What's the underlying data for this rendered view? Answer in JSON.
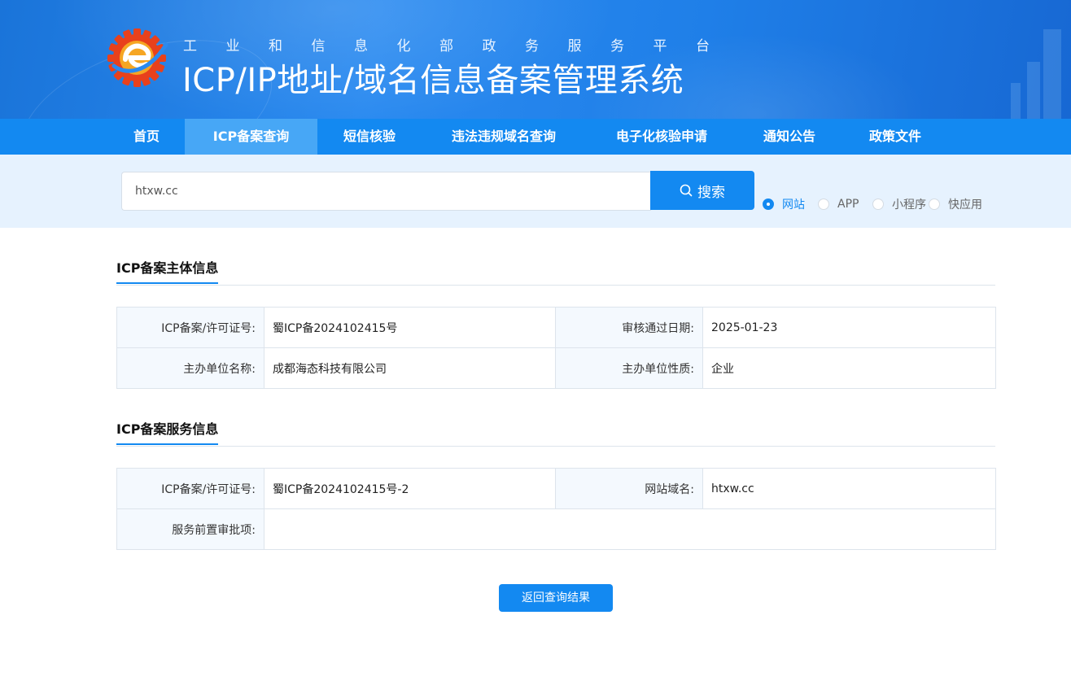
{
  "header": {
    "subtitle": "工业和信息化部政务服务平台",
    "title": "ICP/IP地址/域名信息备案管理系统"
  },
  "nav": {
    "items": [
      {
        "label": "首页"
      },
      {
        "label": "ICP备案查询",
        "active": true
      },
      {
        "label": "短信核验"
      },
      {
        "label": "违法违规域名查询"
      },
      {
        "label": "电子化核验申请"
      },
      {
        "label": "通知公告"
      },
      {
        "label": "政策文件"
      }
    ]
  },
  "search": {
    "value": "htxw.cc",
    "button_label": "搜索",
    "types": [
      {
        "label": "网站",
        "checked": true
      },
      {
        "label": "APP",
        "checked": false
      },
      {
        "label": "小程序",
        "checked": false
      },
      {
        "label": "快应用",
        "checked": false
      }
    ]
  },
  "subject_info": {
    "title": "ICP备案主体信息",
    "license_label": "ICP备案/许可证号:",
    "license_value": "蜀ICP备2024102415号",
    "date_label": "审核通过日期:",
    "date_value": "2025-01-23",
    "org_label": "主办单位名称:",
    "org_value": "成都海态科技有限公司",
    "nature_label": "主办单位性质:",
    "nature_value": "企业"
  },
  "service_info": {
    "title": "ICP备案服务信息",
    "license_label": "ICP备案/许可证号:",
    "license_value": "蜀ICP备2024102415号-2",
    "domain_label": "网站域名:",
    "domain_value": "htxw.cc",
    "approval_label": "服务前置审批项:",
    "approval_value": ""
  },
  "back_button_label": "返回查询结果",
  "colors": {
    "primary": "#1389f1",
    "nav_active": "#47a7f6",
    "search_band": "#e6f2fe",
    "label_cell": "#f4f9fe"
  },
  "icons": {
    "logo": "gear-e-logo-icon",
    "search": "search-icon"
  }
}
